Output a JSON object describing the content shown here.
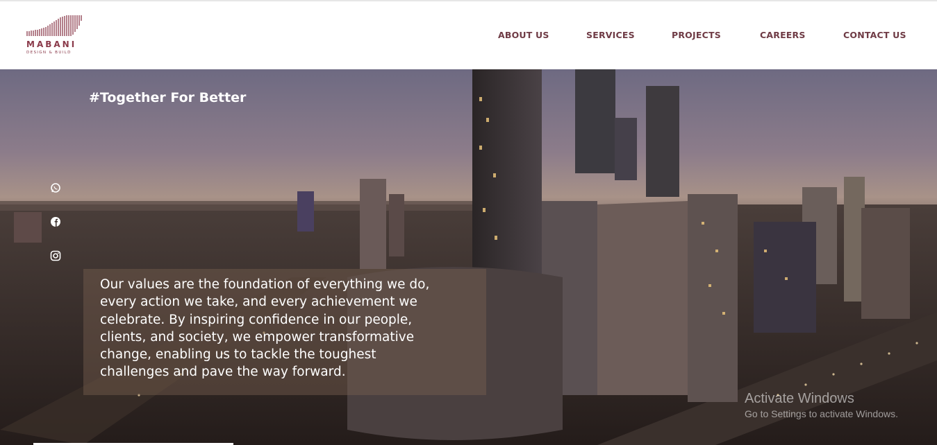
{
  "brand": {
    "name": "MABANI",
    "tagline": "DESIGN & BUILD",
    "accent_color": "#8a3a4a",
    "nav_color": "#6f3b45"
  },
  "nav": {
    "items": [
      {
        "label": "ABOUT US"
      },
      {
        "label": "SERVICES"
      },
      {
        "label": "PROJECTS"
      },
      {
        "label": "CAREERS"
      },
      {
        "label": "CONTACT US"
      }
    ]
  },
  "hero": {
    "title": "#Together For Better",
    "values_text": "Our values are the foundation of everything we do, every action we take, and every achievement we celebrate. By inspiring confidence in our people, clients, and society, we empower transformative change, enabling us to tackle the toughest challenges and pave the way forward.",
    "social_icons": [
      "whatsapp-icon",
      "facebook-icon",
      "instagram-icon"
    ]
  },
  "watermark": {
    "title": "Activate Windows",
    "subtitle": "Go to Settings to activate Windows."
  }
}
